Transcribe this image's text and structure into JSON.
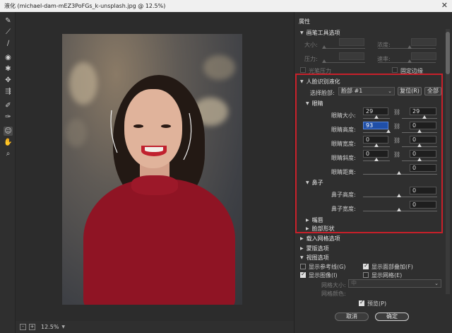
{
  "window": {
    "title": "液化 (michael-dam-mEZ3PoFGs_k-unsplash.jpg @ 12.5%)",
    "close_icon": "close-icon"
  },
  "tools": [
    "forward-warp-icon",
    "reconstruct-icon",
    "smooth-icon",
    "twirl-icon",
    "pucker-icon",
    "bloat-icon",
    "push-left-icon",
    "freeze-mask-icon",
    "thaw-mask-icon",
    "face-tool-icon",
    "hand-icon",
    "zoom-icon"
  ],
  "status": {
    "zoom": "12.5%",
    "minus": "-",
    "plus": "+"
  },
  "panel": {
    "title": "属性",
    "brush": {
      "header": "画笔工具选项",
      "size_label": "大小:",
      "density_label": "浓度:",
      "pressure_label": "压力:",
      "rate_label": "速率:",
      "stylus_label": "光笔压力",
      "pin_edges_label": "固定边缘"
    },
    "face": {
      "header": "人脸识别液化",
      "select_label": "选择脸部:",
      "select_value": "脸部 #1",
      "reset_label": "复位(R)",
      "all_label": "全部",
      "eyes": {
        "header": "眼睛",
        "size_label": "眼睛大小:",
        "size_l": "29",
        "size_r": "29",
        "height_label": "眼睛高度:",
        "height_l": "93",
        "height_r": "0",
        "width_label": "眼睛宽度:",
        "width_l": "0",
        "width_r": "0",
        "tilt_label": "眼睛斜度:",
        "tilt_l": "0",
        "tilt_r": "0",
        "distance_label": "眼睛距离:",
        "distance": "0"
      },
      "nose": {
        "header": "鼻子",
        "height_label": "鼻子高度:",
        "height": "0",
        "width_label": "鼻子宽度:",
        "width": "0"
      },
      "mouth_header": "嘴唇",
      "face_shape_header": "脸部形状"
    },
    "load_mesh_header": "载入网格选项",
    "mask_header": "蒙版选项",
    "view": {
      "header": "视图选项",
      "guides_label": "显示参考线(G)",
      "face_overlay_label": "显示面部叠加(F)",
      "image_label": "显示图像(I)",
      "mesh_label": "显示网格(E)",
      "mesh_size_label": "网格大小:",
      "mesh_size_value": "中",
      "mesh_color_label": "网格颜色:"
    },
    "preview_label": "预览(P)",
    "cancel_label": "取消",
    "ok_label": "确定"
  }
}
